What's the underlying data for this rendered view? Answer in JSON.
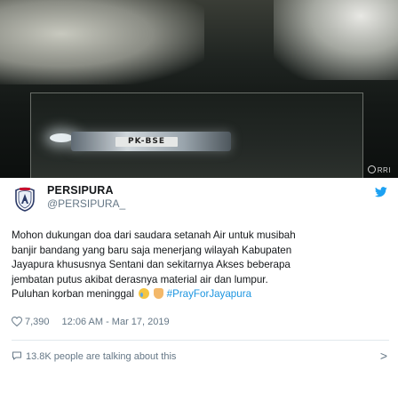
{
  "media": {
    "plate_text": "PK-BSE",
    "watermark": "RRI"
  },
  "account": {
    "name": "PERSIPURA",
    "handle": "@PERSIPURA_",
    "avatar_icon": "persipura-crest-icon",
    "platform_icon": "twitter-bird-icon"
  },
  "tweet": {
    "lines": [
      "Mohon dukungan doa dari saudara setanah Air untuk musibah",
      "banjir bandang yang baru saja menerjang wilayah Kabupaten",
      "Jayapura khususnya Sentani dan sekitarnya Akses beberapa",
      "jembatan putus akibat derasnya material air dan lumpur."
    ],
    "last_line_text": "Puluhan korban meninggal",
    "hashtag": "#PrayForJayapura"
  },
  "meta": {
    "likes": "7,390",
    "timestamp": "12:06 AM - Mar 17, 2019"
  },
  "footer": {
    "talking": "13.8K people are talking about this",
    "chevron": ">"
  },
  "colors": {
    "link": "#1b95e0",
    "muted": "#657786",
    "divider": "#e1e8ed"
  }
}
